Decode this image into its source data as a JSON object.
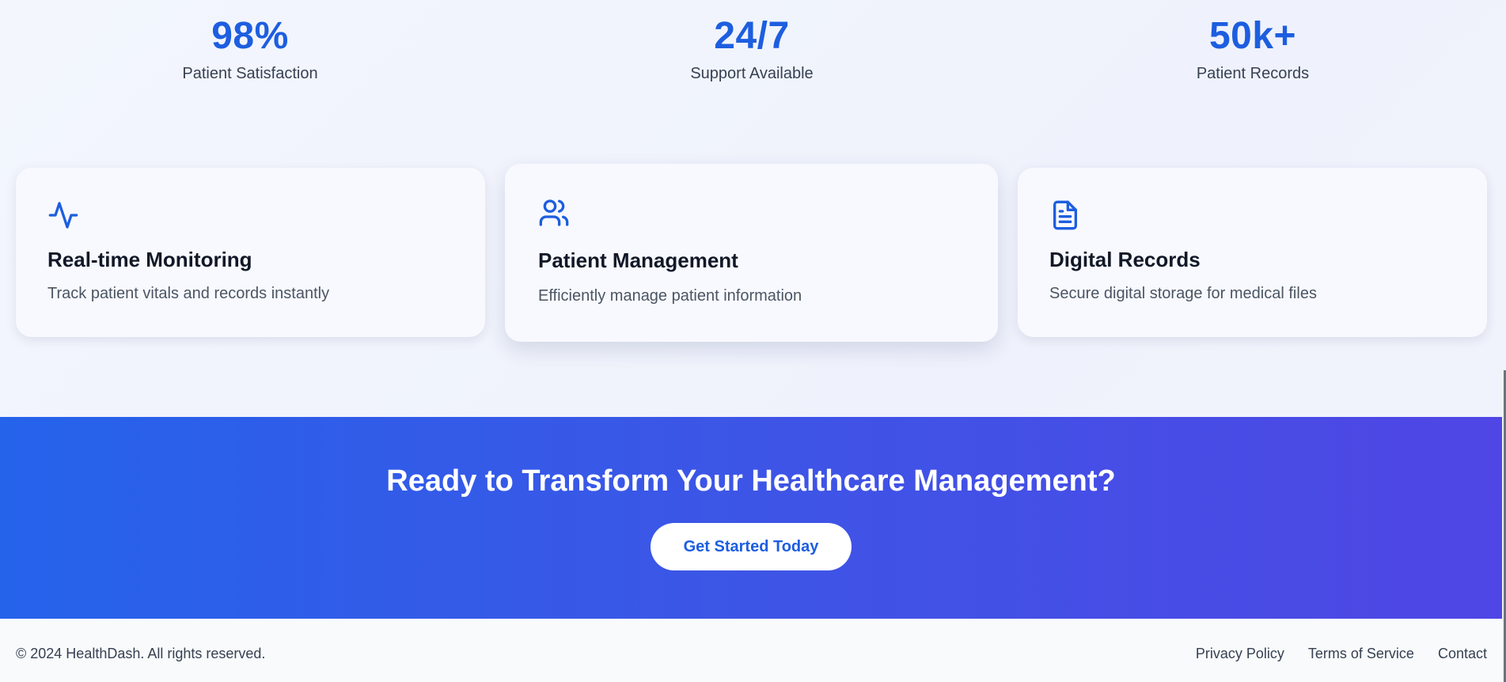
{
  "stats": [
    {
      "value": "98%",
      "label": "Patient Satisfaction"
    },
    {
      "value": "24/7",
      "label": "Support Available"
    },
    {
      "value": "50k+",
      "label": "Patient Records"
    }
  ],
  "features": [
    {
      "icon": "activity-icon",
      "title": "Real-time Monitoring",
      "description": "Track patient vitals and records instantly"
    },
    {
      "icon": "users-icon",
      "title": "Patient Management",
      "description": "Efficiently manage patient information"
    },
    {
      "icon": "document-icon",
      "title": "Digital Records",
      "description": "Secure digital storage for medical files"
    }
  ],
  "cta": {
    "title": "Ready to Transform Your Healthcare Management?",
    "button_label": "Get Started Today"
  },
  "footer": {
    "copyright": "© 2024 HealthDash. All rights reserved.",
    "links": [
      "Privacy Policy",
      "Terms of Service",
      "Contact"
    ]
  },
  "colors": {
    "accent": "#1d5ee0",
    "cta_gradient_start": "#2563eb",
    "cta_gradient_end": "#4f46e5",
    "footer_background": "#f8fafc"
  }
}
